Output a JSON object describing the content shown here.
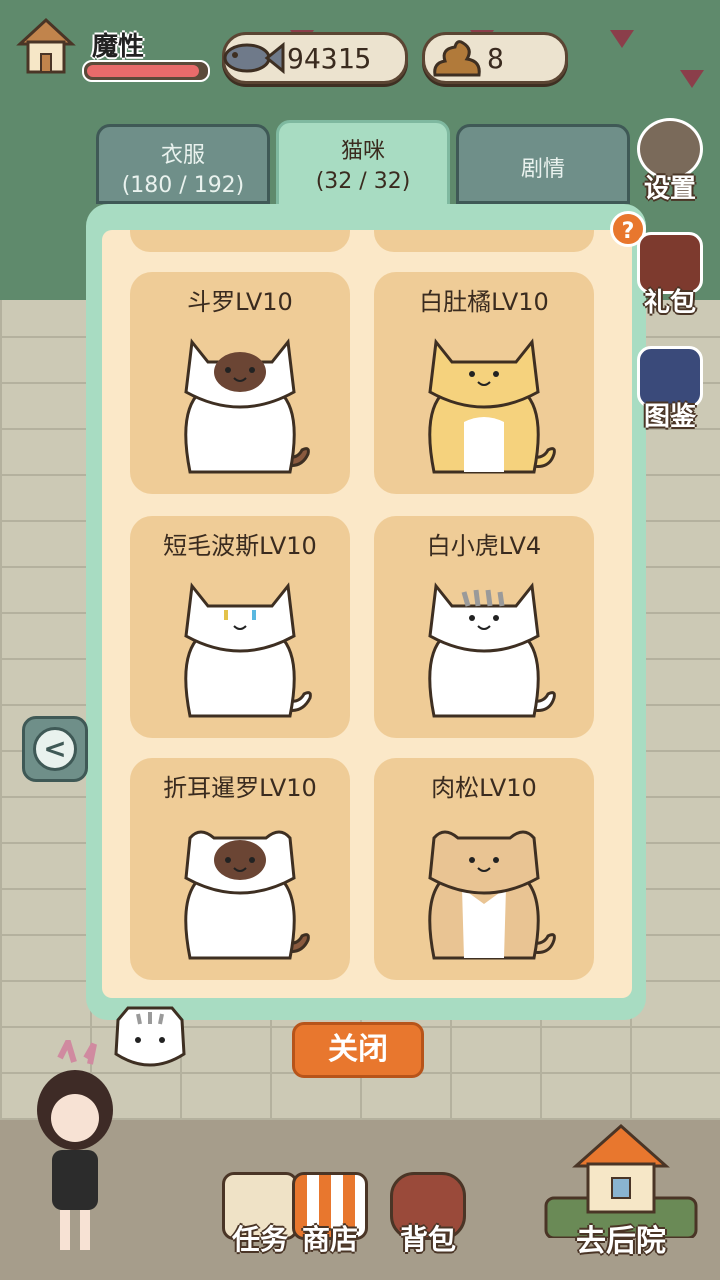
{
  "hud": {
    "player_name": "魔性",
    "health_fraction": 0.95,
    "coins": "94315",
    "poop": "8"
  },
  "tabs": [
    {
      "label": "衣服",
      "count": "(180 / 192)"
    },
    {
      "label": "猫咪",
      "count": "(32 / 32)"
    },
    {
      "label": "剧情",
      "count": ""
    }
  ],
  "help": "?",
  "cats": [
    {
      "label": "斗罗LV10",
      "coat": "siamese"
    },
    {
      "label": "白肚橘LV10",
      "coat": "orange-white"
    },
    {
      "label": "短毛波斯LV10",
      "coat": "white-odd-eye"
    },
    {
      "label": "白小虎LV4",
      "coat": "grey-tabby-white"
    },
    {
      "label": "折耳暹罗LV10",
      "coat": "siamese-fold"
    },
    {
      "label": "肉松LV10",
      "coat": "cream-fold"
    }
  ],
  "side_nav": [
    {
      "label": "设置",
      "icon": "gear-icon"
    },
    {
      "label": "礼包",
      "icon": "gift-bag-icon"
    },
    {
      "label": "图鉴",
      "icon": "album-icon"
    }
  ],
  "close_label": "关闭",
  "bottom_nav": [
    {
      "label": "任务",
      "icon": "task-scroll-icon"
    },
    {
      "label": "商店",
      "icon": "shop-awning-icon"
    },
    {
      "label": "背包",
      "icon": "backpack-icon"
    }
  ],
  "yard_label": "去后院",
  "colors": {
    "panel": "#a8dcc2",
    "panel_inner": "#fbe8c8",
    "card": "#efcc97",
    "accent_orange": "#e8772e",
    "tab_inactive": "#6f8f89"
  }
}
